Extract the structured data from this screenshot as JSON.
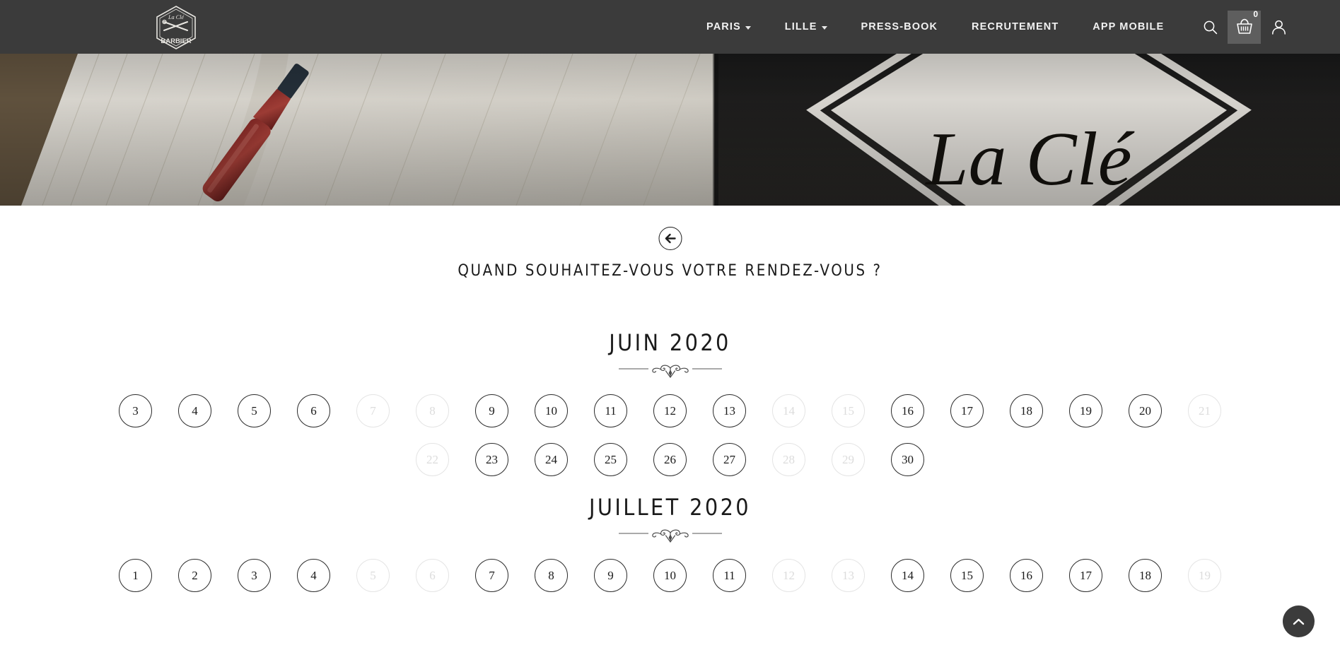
{
  "header": {
    "logo_alt": "La Clé du Barbier",
    "logo_line1": "La Clé",
    "logo_line2": "BARBIER",
    "nav": [
      {
        "label": "PARIS",
        "has_dropdown": true
      },
      {
        "label": "LILLE",
        "has_dropdown": true
      },
      {
        "label": "PRESS-BOOK",
        "has_dropdown": false
      },
      {
        "label": "RECRUTEMENT",
        "has_dropdown": false
      },
      {
        "label": "APP MOBILE",
        "has_dropdown": false
      }
    ],
    "icons": {
      "search": "search-icon",
      "basket": "basket-icon",
      "account": "user-icon"
    },
    "basket_count": "0",
    "background_color": "#3b3b3b"
  },
  "hero": {
    "alt": "Carnet de rendez-vous avec stylo et enseigne La Clé du Barbier"
  },
  "main": {
    "back_button": "back-arrow",
    "title": "QUAND SOUHAITEZ-VOUS VOTRE RENDEZ-VOUS ?",
    "months": [
      {
        "title": "JUIN 2020",
        "rows": [
          [
            {
              "day": "3",
              "available": true
            },
            {
              "day": "4",
              "available": true
            },
            {
              "day": "5",
              "available": true
            },
            {
              "day": "6",
              "available": true
            },
            {
              "day": "7",
              "available": false
            },
            {
              "day": "8",
              "available": false
            },
            {
              "day": "9",
              "available": true
            },
            {
              "day": "10",
              "available": true
            },
            {
              "day": "11",
              "available": true
            },
            {
              "day": "12",
              "available": true
            },
            {
              "day": "13",
              "available": true
            },
            {
              "day": "14",
              "available": false
            },
            {
              "day": "15",
              "available": false
            },
            {
              "day": "16",
              "available": true
            },
            {
              "day": "17",
              "available": true
            },
            {
              "day": "18",
              "available": true
            },
            {
              "day": "19",
              "available": true
            },
            {
              "day": "20",
              "available": true
            },
            {
              "day": "21",
              "available": false
            }
          ],
          [
            {
              "day": "22",
              "available": false
            },
            {
              "day": "23",
              "available": true
            },
            {
              "day": "24",
              "available": true
            },
            {
              "day": "25",
              "available": true
            },
            {
              "day": "26",
              "available": true
            },
            {
              "day": "27",
              "available": true
            },
            {
              "day": "28",
              "available": false
            },
            {
              "day": "29",
              "available": false
            },
            {
              "day": "30",
              "available": true
            }
          ]
        ]
      },
      {
        "title": "JUILLET 2020",
        "rows": [
          [
            {
              "day": "1",
              "available": true
            },
            {
              "day": "2",
              "available": true
            },
            {
              "day": "3",
              "available": true
            },
            {
              "day": "4",
              "available": true
            },
            {
              "day": "5",
              "available": false
            },
            {
              "day": "6",
              "available": false
            },
            {
              "day": "7",
              "available": true
            },
            {
              "day": "8",
              "available": true
            },
            {
              "day": "9",
              "available": true
            },
            {
              "day": "10",
              "available": true
            },
            {
              "day": "11",
              "available": true
            },
            {
              "day": "12",
              "available": false
            },
            {
              "day": "13",
              "available": false
            },
            {
              "day": "14",
              "available": true
            },
            {
              "day": "15",
              "available": true
            },
            {
              "day": "16",
              "available": true
            },
            {
              "day": "17",
              "available": true
            },
            {
              "day": "18",
              "available": true
            },
            {
              "day": "19",
              "available": false
            }
          ]
        ]
      }
    ]
  },
  "scroll_top": {
    "icon": "chevron-up-icon"
  }
}
